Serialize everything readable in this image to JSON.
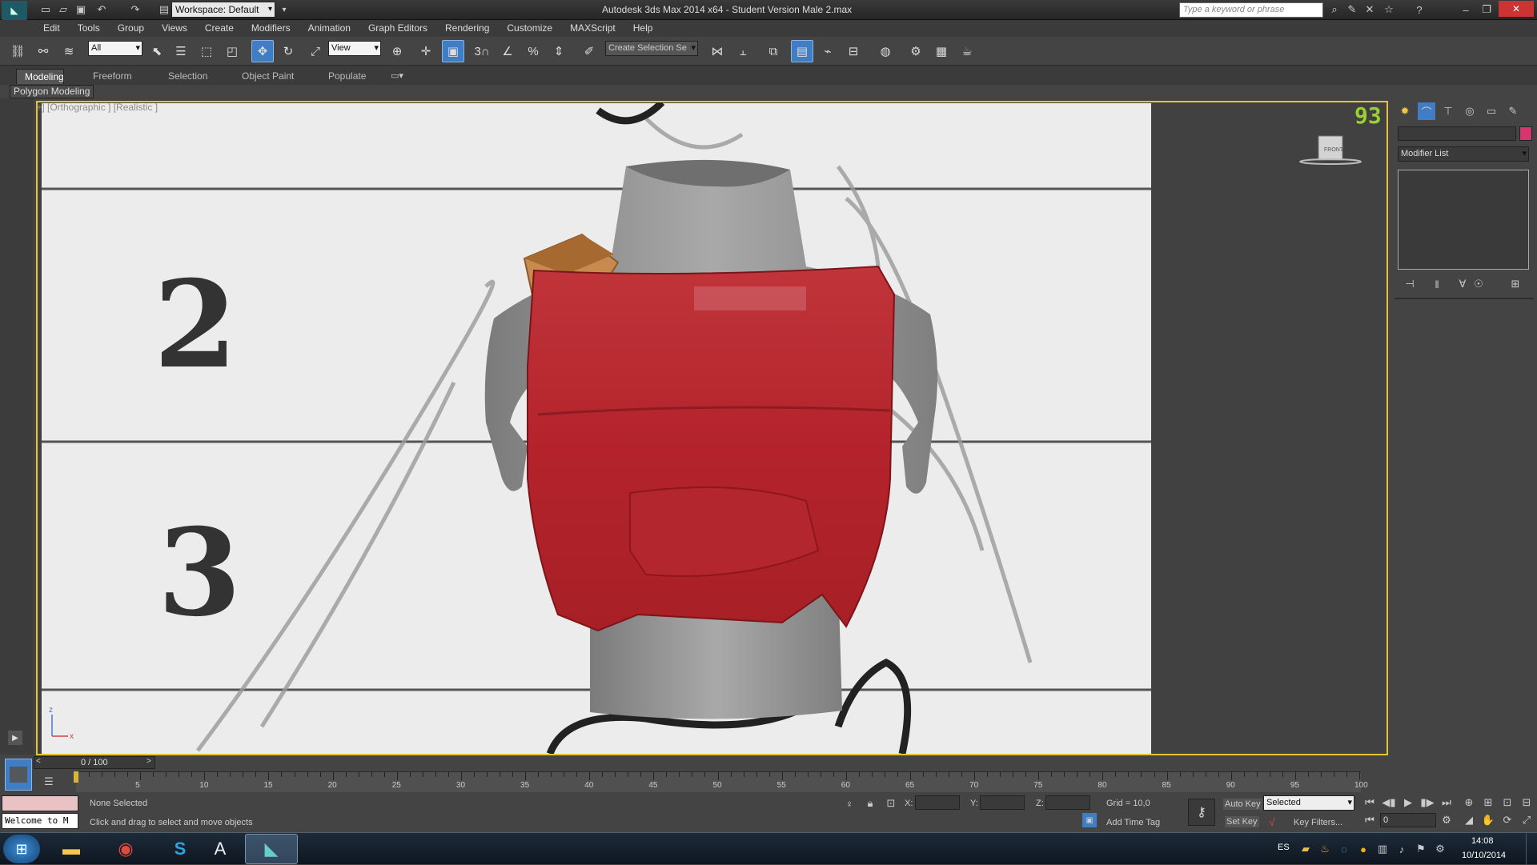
{
  "title": {
    "workspace": "Workspace: Default",
    "window_title": "Autodesk 3ds Max  2014 x64  - Student Version   Male 2.max",
    "search_placeholder": "Type a keyword or phrase"
  },
  "menus": [
    "Edit",
    "Tools",
    "Group",
    "Views",
    "Create",
    "Modifiers",
    "Animation",
    "Graph Editors",
    "Rendering",
    "Customize",
    "MAXScript",
    "Help"
  ],
  "toolbar": {
    "selection_filter": "All",
    "ref_coord": "View",
    "named_selection": "Create Selection Se",
    "snap_label": "3"
  },
  "ribbon": {
    "tabs": [
      "Modeling",
      "Freeform",
      "Selection",
      "Object Paint",
      "Populate"
    ],
    "panel_label": "Polygon Modeling"
  },
  "viewport": {
    "label": "[+] [Orthographic ] [Realistic ]",
    "fps_counter": "93",
    "viewcube_face": "FRONT",
    "background_numbers": [
      "2",
      "3"
    ],
    "axis_z": "z",
    "axis_x": "x"
  },
  "command_panel": {
    "modifier_list": "Modifier List",
    "color_swatch": "#d8346e"
  },
  "timeline": {
    "frame_counter": "0 / 100",
    "ticks": [
      "5",
      "10",
      "15",
      "20",
      "25",
      "30",
      "35",
      "40",
      "45",
      "50",
      "55",
      "60",
      "65",
      "70",
      "75",
      "80",
      "85",
      "90",
      "95",
      "100"
    ],
    "ticks_pos": [
      5,
      10,
      15,
      20,
      25,
      30,
      35,
      40,
      45,
      50,
      55,
      60,
      65,
      70,
      75,
      80,
      85,
      90,
      95,
      100
    ]
  },
  "status": {
    "maxscript_listener": "Welcome to M",
    "selection_status": "None Selected",
    "prompt": "Click and drag to select and move objects",
    "x_label": "X:",
    "y_label": "Y:",
    "z_label": "Z:",
    "grid": "Grid = 10,0",
    "add_time_tag": "Add Time Tag",
    "auto_key": "Auto Key",
    "set_key": "Set Key",
    "selected": "Selected",
    "key_filters": "Key Filters...",
    "current_frame": "0"
  },
  "taskbar": {
    "language": "ES",
    "time": "14:08",
    "date": "10/10/2014",
    "apps": [
      "start-orb",
      "explorer",
      "chrome",
      "skype",
      "autocad",
      "3dsmax"
    ]
  },
  "colors": {
    "active_viewport_border": "#e4c52f",
    "red_mesh": "#b8262c",
    "gray_mesh": "#8c8c8c",
    "orange_piece": "#c98a4f"
  }
}
